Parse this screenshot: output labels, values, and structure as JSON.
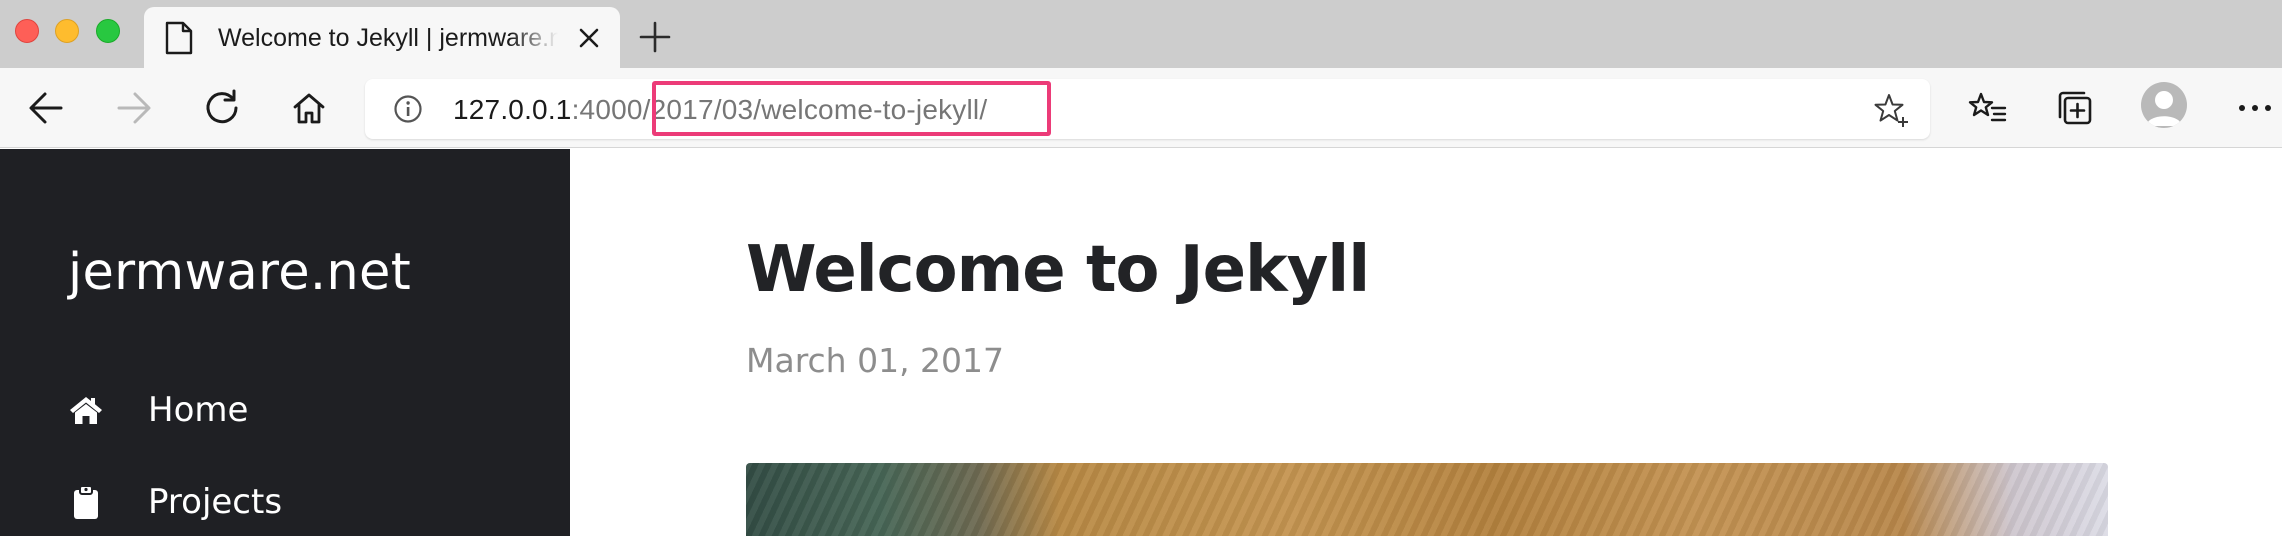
{
  "browser": {
    "tab_title": "Welcome to Jekyll | jermware.net",
    "url": {
      "host": "127.0.0.1",
      "port": ":4000",
      "path": "/2017/03/welcome-to-jekyll/"
    }
  },
  "sidebar": {
    "site_name": "jermware.net",
    "nav": [
      {
        "label": "Home",
        "icon": "home-icon"
      },
      {
        "label": "Projects",
        "icon": "clipboard-icon"
      }
    ]
  },
  "post": {
    "title": "Welcome to Jekyll",
    "date": "March 01, 2017"
  },
  "colors": {
    "sidebar_bg": "#1f2024",
    "highlight": "#ec3b78",
    "title_text": "#222326",
    "date_text": "#8d8d8d"
  }
}
